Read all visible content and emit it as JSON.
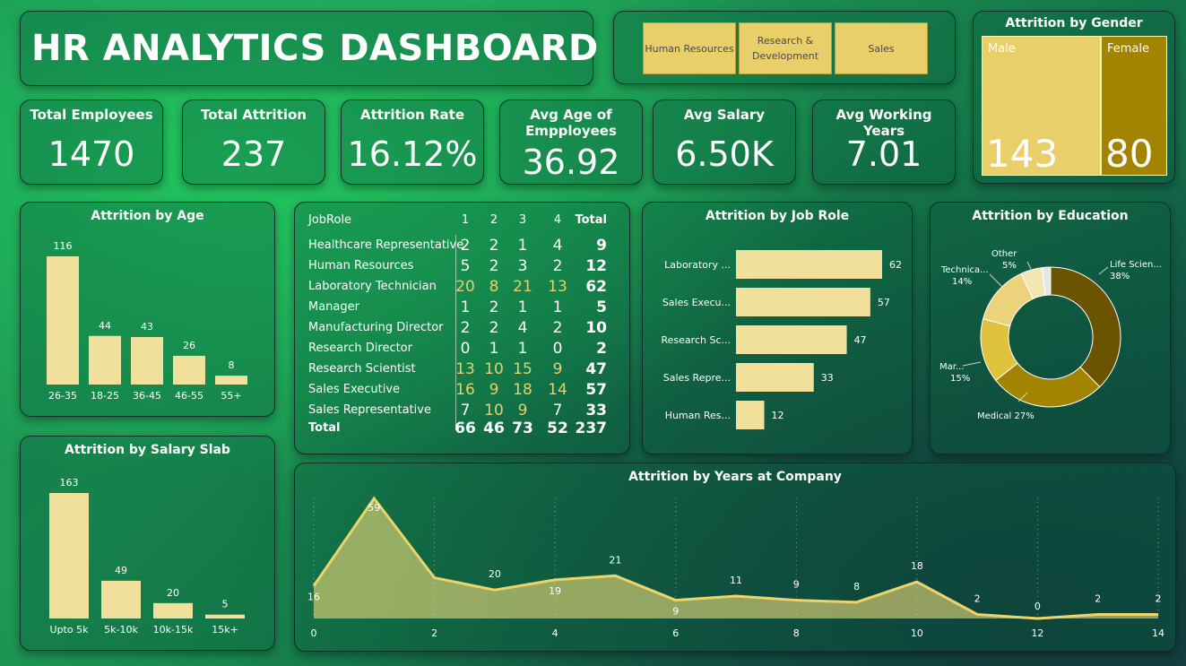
{
  "dashboard": {
    "title": "HR ANALYTICS DASHBOARD"
  },
  "slicer": {
    "items": [
      "Human Resources",
      "Research & Development",
      "Sales"
    ]
  },
  "kpis": {
    "total_employees": {
      "label": "Total Employees",
      "value": "1470"
    },
    "total_attrition": {
      "label": "Total Attrition",
      "value": "237"
    },
    "attrition_rate": {
      "label": "Attrition Rate",
      "value": "16.12%"
    },
    "avg_age": {
      "label": "Avg Age of Empployees",
      "value": "36.92"
    },
    "avg_salary": {
      "label": "Avg Salary",
      "value": "6.50K"
    },
    "avg_working_years": {
      "label": "Avg Working Years",
      "value": "7.01"
    }
  },
  "colors": {
    "bar": "#f0e09c",
    "gold_light": "#e8cf6a",
    "gold_dark": "#a38400",
    "highlight_text": "#e8cf6a"
  },
  "chart_data": [
    {
      "id": "gender",
      "type": "treemap",
      "title": "Attrition by Gender",
      "categories": [
        "Male",
        "Female"
      ],
      "values": [
        143,
        80
      ],
      "colors": [
        "#e8cf6a",
        "#a38400"
      ]
    },
    {
      "id": "age",
      "type": "bar",
      "title": "Attrition by Age",
      "categories": [
        "26-35",
        "18-25",
        "36-45",
        "46-55",
        "55+"
      ],
      "values": [
        116,
        44,
        43,
        26,
        8
      ],
      "ylim": [
        0,
        116
      ]
    },
    {
      "id": "salary",
      "type": "bar",
      "title": "Attrition by Salary Slab",
      "categories": [
        "Upto 5k",
        "5k-10k",
        "10k-15k",
        "15k+"
      ],
      "values": [
        163,
        49,
        20,
        5
      ],
      "ylim": [
        0,
        163
      ]
    },
    {
      "id": "jobrole_matrix",
      "type": "table",
      "columns": [
        "JobRole",
        "1",
        "2",
        "3",
        "4",
        "Total"
      ],
      "rows": [
        {
          "role": "Healthcare Representative",
          "values": [
            2,
            2,
            1,
            4
          ],
          "total": 9
        },
        {
          "role": "Human Resources",
          "values": [
            5,
            2,
            3,
            2
          ],
          "total": 12
        },
        {
          "role": "Laboratory Technician",
          "values": [
            20,
            8,
            21,
            13
          ],
          "total": 62
        },
        {
          "role": "Manager",
          "values": [
            1,
            2,
            1,
            1
          ],
          "total": 5
        },
        {
          "role": "Manufacturing Director",
          "values": [
            2,
            2,
            4,
            2
          ],
          "total": 10
        },
        {
          "role": "Research Director",
          "values": [
            0,
            1,
            1,
            0
          ],
          "total": 2
        },
        {
          "role": "Research Scientist",
          "values": [
            13,
            10,
            15,
            9
          ],
          "total": 47
        },
        {
          "role": "Sales Executive",
          "values": [
            16,
            9,
            18,
            14
          ],
          "total": 57
        },
        {
          "role": "Sales Representative",
          "values": [
            7,
            10,
            9,
            7
          ],
          "total": 33
        }
      ],
      "total_row": {
        "role": "Total",
        "values": [
          66,
          46,
          73,
          52
        ],
        "total": 237
      }
    },
    {
      "id": "jobrole_bar",
      "type": "bar",
      "orientation": "horizontal",
      "title": "Attrition by Job Role",
      "categories": [
        "Laboratory ...",
        "Sales Execu...",
        "Research Sc...",
        "Sales Repre...",
        "Human Res..."
      ],
      "values": [
        62,
        57,
        47,
        33,
        12
      ],
      "xlim": [
        0,
        62
      ]
    },
    {
      "id": "education",
      "type": "pie",
      "donut": true,
      "title": "Attrition by Education",
      "slices": [
        {
          "label": "Life Scien...",
          "pct_label": "38%",
          "value": 38,
          "color": "#6b5400"
        },
        {
          "label": "Medical",
          "pct_label": "27%",
          "value": 27,
          "color": "#a38400"
        },
        {
          "label": "Mar...",
          "pct_label": "15%",
          "value": 15,
          "color": "#e0c33c"
        },
        {
          "label": "Technica...",
          "pct_label": "14%",
          "value": 14,
          "color": "#ecd27a"
        },
        {
          "label": "Other",
          "pct_label": "5%",
          "value": 5,
          "color": "#f3e6b0"
        },
        {
          "label": "",
          "pct_label": "",
          "value": 2,
          "color": "#e6e6e6"
        }
      ]
    },
    {
      "id": "years",
      "type": "area",
      "title": "Attrition by Years at Company",
      "x": [
        0,
        1,
        2,
        3,
        4,
        5,
        6,
        7,
        8,
        9,
        10,
        11,
        12,
        13,
        14
      ],
      "values": [
        16,
        59,
        20,
        14,
        19,
        21,
        9,
        11,
        9,
        8,
        18,
        2,
        0,
        2,
        2
      ],
      "point_labels": [
        "16",
        "59",
        "",
        "20",
        "19",
        "21",
        "9",
        "11",
        "9",
        "8",
        "18",
        "2",
        "0",
        "2",
        "2"
      ],
      "xticks": [
        0,
        2,
        4,
        6,
        8,
        10,
        12,
        14
      ],
      "xlim": [
        0,
        14
      ],
      "ylim": [
        0,
        59
      ]
    }
  ]
}
